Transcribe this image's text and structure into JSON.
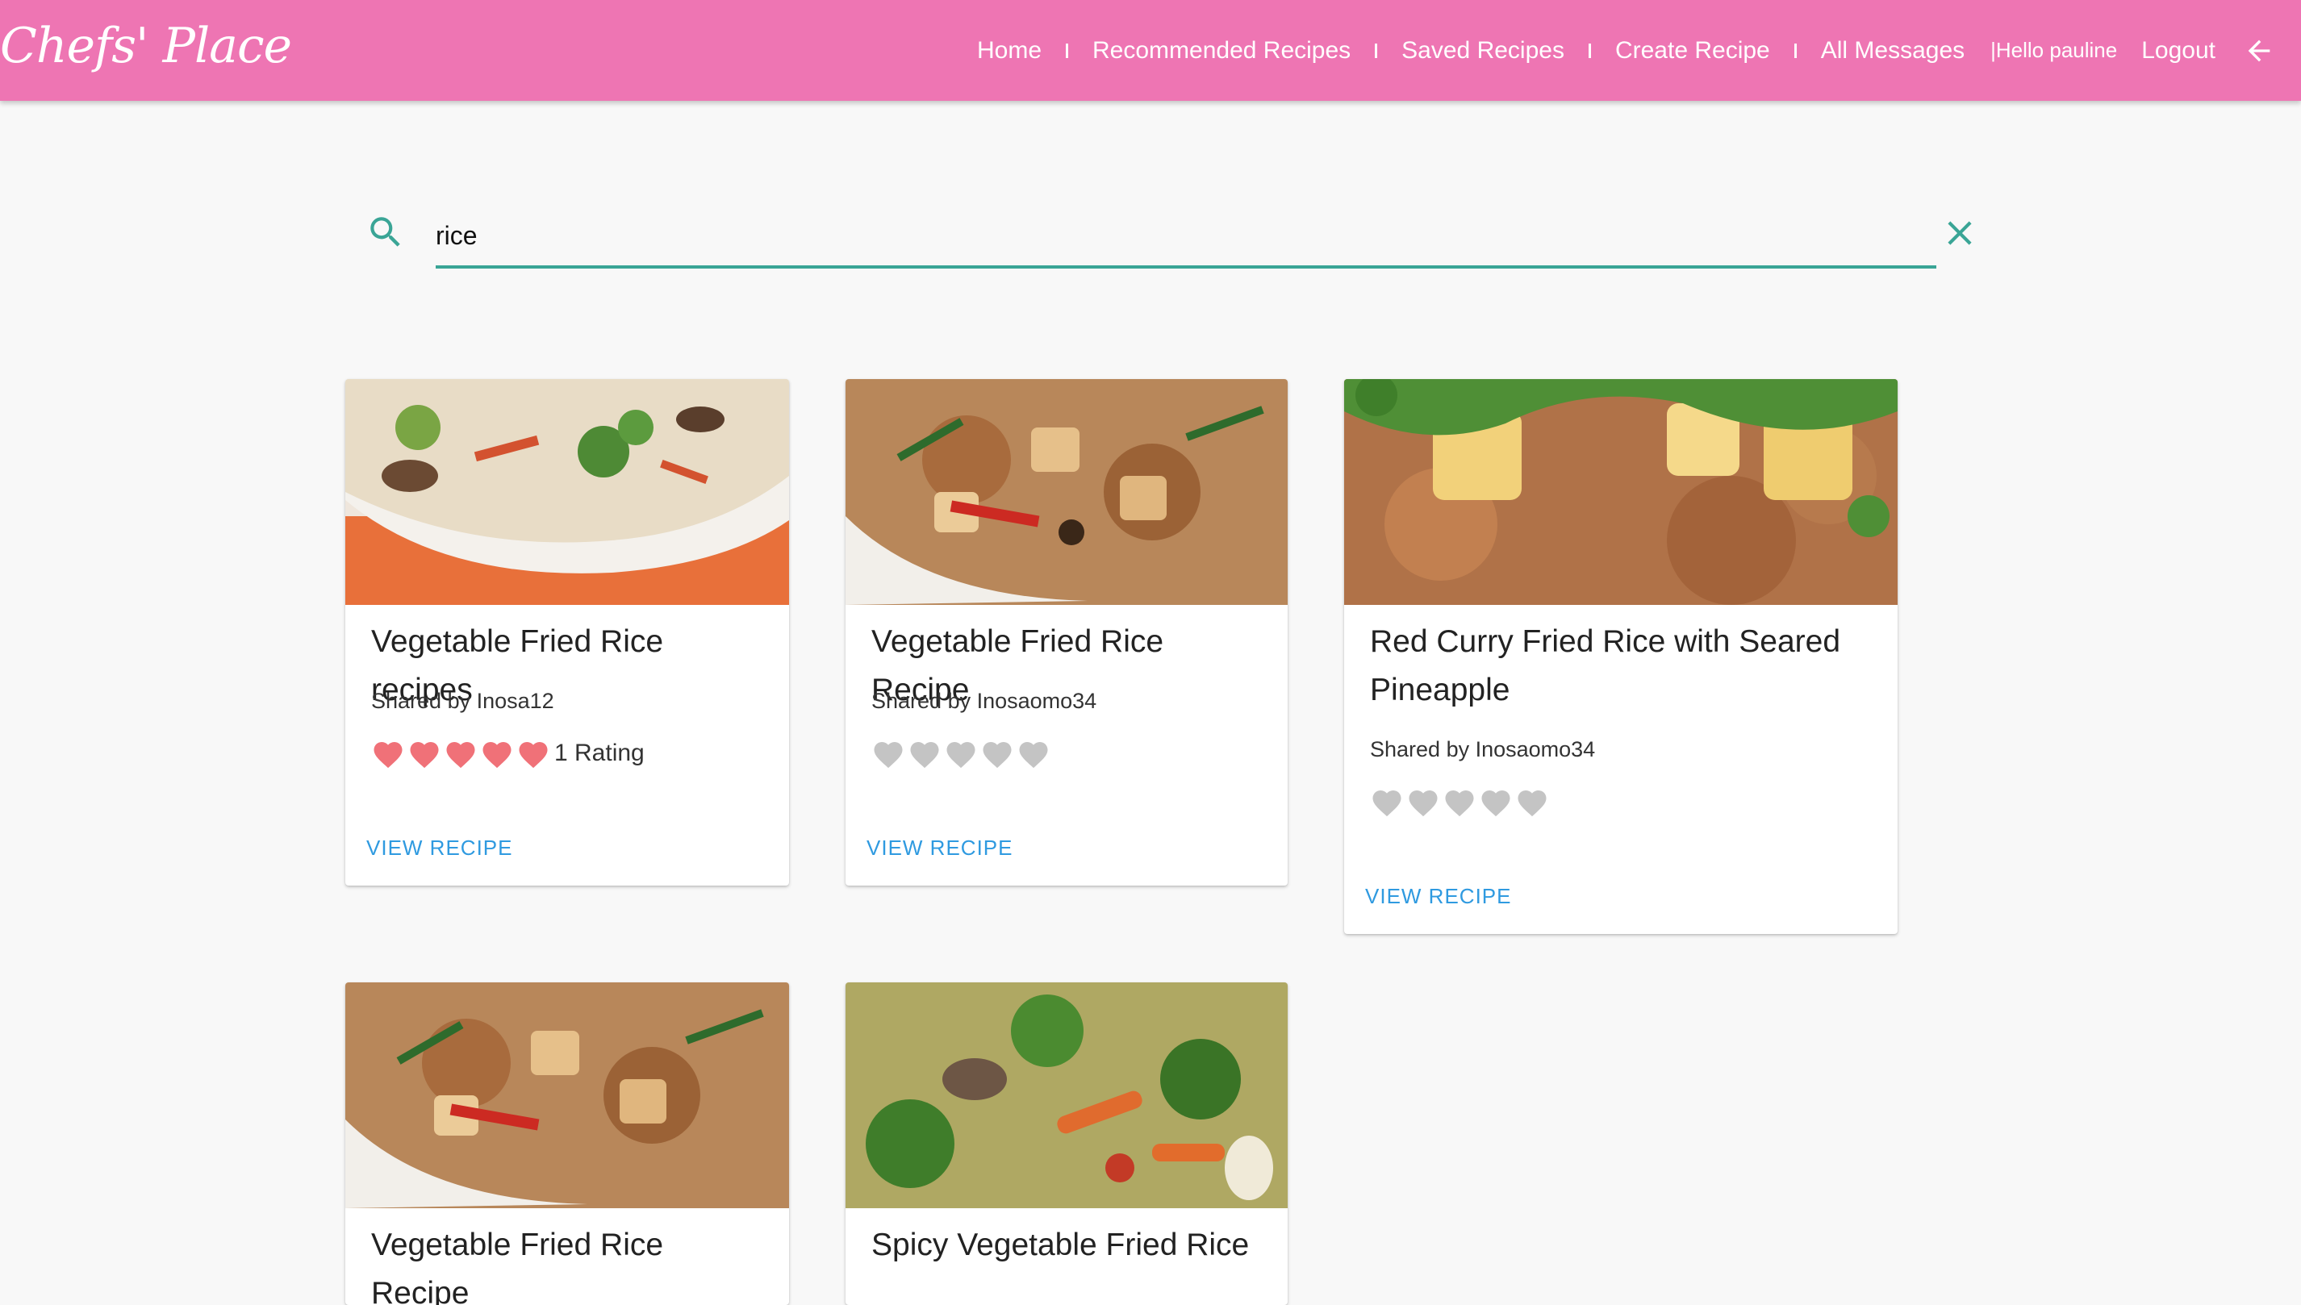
{
  "brand": {
    "name": "Chefs' Place"
  },
  "nav": {
    "items": [
      "Home",
      "Recommended Recipes",
      "Saved Recipes",
      "Create Recipe",
      "All Messages"
    ],
    "greeting": "|Hello pauline",
    "logout": "Logout",
    "back_icon": "arrow-left-icon"
  },
  "colors": {
    "navbar": "#ee75b3",
    "accent": "#3aa596",
    "link": "#2f9ae0",
    "heart_active": "#f07178",
    "heart_inactive": "#c4c4c4"
  },
  "search": {
    "value": "rice",
    "icon": "search-icon",
    "clear_icon": "close-icon"
  },
  "recipes": [
    {
      "title": "Vegetable Fried Rice recipes",
      "shared": "Shared by Inosa12",
      "rating": 5,
      "rating_label": "1 Rating",
      "action": "VIEW RECIPE"
    },
    {
      "title": "Vegetable Fried Rice Recipe",
      "shared": "Shared by Inosaomo34",
      "rating": 0,
      "rating_label": "",
      "action": "VIEW RECIPE"
    },
    {
      "title": "Red Curry Fried Rice with Seared Pineapple",
      "shared": "Shared by Inosaomo34",
      "rating": 0,
      "rating_label": "",
      "action": "VIEW RECIPE"
    },
    {
      "title": "Vegetable Fried Rice Recipe",
      "shared": "",
      "rating": 0,
      "rating_label": "",
      "action": ""
    },
    {
      "title": "Spicy Vegetable Fried Rice",
      "shared": "",
      "rating": 0,
      "rating_label": "",
      "action": ""
    }
  ]
}
